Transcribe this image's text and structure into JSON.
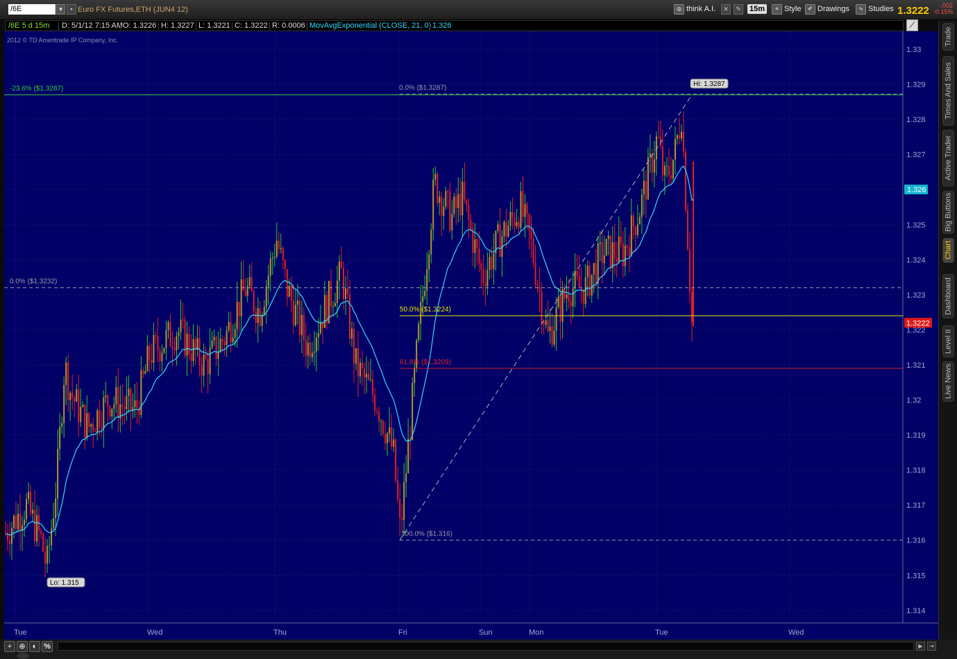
{
  "toolbar": {
    "symbol": "/6E",
    "description": "Euro FX Futures,ETH (JUN4 12)",
    "think_ai": "think A.I.",
    "aggregation": "15m",
    "style": "Style",
    "drawings": "Drawings",
    "studies": "Studies",
    "last_price": "1.3222",
    "net_change": "-.002",
    "pct_change": "-0.15%"
  },
  "infobar": {
    "symbol_period": "/6E 5 d 15m",
    "date": "D: 5/1/12 7:15 AM",
    "open": "O: 1.3226",
    "high": "H: 1.3227",
    "low": "L: 1.3221",
    "close": "C: 1.3222",
    "range": "R: 0.0006",
    "study": "MovAvgExponential (CLOSE, 21, 0)",
    "study_value": "1.326"
  },
  "copyright": "2012 © TD Ameritrade IP Company, Inc.",
  "sidebar": {
    "tabs": [
      "Trade",
      "Times And Sales",
      "Active Trader",
      "Big Buttons",
      "Chart",
      "Dashboard",
      "Level II",
      "Live News"
    ],
    "active": "Chart"
  },
  "colors": {
    "background": "#000066",
    "up_candle": "#2ec82e",
    "down_candle": "#e02020",
    "ema": "#35d7ff",
    "fib_top": "#33cc33",
    "fib_50": "#e8e800",
    "fib_618": "#dd2222",
    "fib_neutral": "#9a9aaa"
  },
  "chart_data": {
    "type": "candlestick",
    "x_ticks": [
      "Tue",
      "Wed",
      "Thu",
      "Fri",
      "Sun",
      "Mon",
      "Tue",
      "Wed"
    ],
    "y_ticks": [
      "1.33",
      "1.329",
      "1.328",
      "1.327",
      "1.326",
      "1.325",
      "1.324",
      "1.323",
      "1.322",
      "1.321",
      "1.32",
      "1.319",
      "1.318",
      "1.317",
      "1.316",
      "1.315",
      "1.314"
    ],
    "ylim": [
      1.3136,
      1.3308
    ],
    "price_path": [
      [
        0.0,
        1.3162
      ],
      [
        0.03,
        1.317
      ],
      [
        0.052,
        1.316
      ],
      [
        0.06,
        1.3152
      ],
      [
        0.075,
        1.3178
      ],
      [
        0.086,
        1.321
      ],
      [
        0.095,
        1.3202
      ],
      [
        0.12,
        1.3192
      ],
      [
        0.15,
        1.32
      ],
      [
        0.19,
        1.3197
      ],
      [
        0.21,
        1.3213
      ],
      [
        0.25,
        1.322
      ],
      [
        0.29,
        1.321
      ],
      [
        0.32,
        1.3218
      ],
      [
        0.35,
        1.3232
      ],
      [
        0.37,
        1.3225
      ],
      [
        0.395,
        1.3246
      ],
      [
        0.41,
        1.3232
      ],
      [
        0.44,
        1.3215
      ],
      [
        0.47,
        1.3228
      ],
      [
        0.49,
        1.3236
      ],
      [
        0.51,
        1.321
      ],
      [
        0.54,
        1.32
      ],
      [
        0.565,
        1.3185
      ],
      [
        0.575,
        1.3162
      ],
      [
        0.6,
        1.3215
      ],
      [
        0.625,
        1.3262
      ],
      [
        0.65,
        1.3252
      ],
      [
        0.665,
        1.3258
      ],
      [
        0.695,
        1.3235
      ],
      [
        0.72,
        1.3246
      ],
      [
        0.75,
        1.3255
      ],
      [
        0.765,
        1.3245
      ],
      [
        0.79,
        1.3218
      ],
      [
        0.82,
        1.3232
      ],
      [
        0.845,
        1.3232
      ],
      [
        0.87,
        1.3242
      ],
      [
        0.9,
        1.3242
      ],
      [
        0.925,
        1.3255
      ],
      [
        0.95,
        1.3275
      ],
      [
        0.96,
        1.3262
      ],
      [
        0.975,
        1.327
      ],
      [
        0.985,
        1.3282
      ],
      [
        0.99,
        1.3262
      ],
      [
        1.0,
        1.3222
      ]
    ],
    "ema_label": "MovAvgExponential (CLOSE, 21, 0)",
    "ema_last": 1.326,
    "current_price": 1.3222,
    "high": {
      "label": "Hi: 1.3287",
      "value": 1.3287
    },
    "low": {
      "label": "Lo: 1.315",
      "value": 1.315
    },
    "fibonacci": [
      {
        "label": "-23.6%  ($1.3287)",
        "value": 1.3287
      },
      {
        "label": "0.0%  ($1.3287)",
        "value": 1.3287
      },
      {
        "label": "0.0%  ($1.3232)",
        "value": 1.3232
      },
      {
        "label": "50.0%  ($1.3224)",
        "value": 1.3224
      },
      {
        "label": "61.8%  ($1.3209)",
        "value": 1.3209
      },
      {
        "label": "100.0%  ($1.316)",
        "value": 1.316
      }
    ]
  }
}
